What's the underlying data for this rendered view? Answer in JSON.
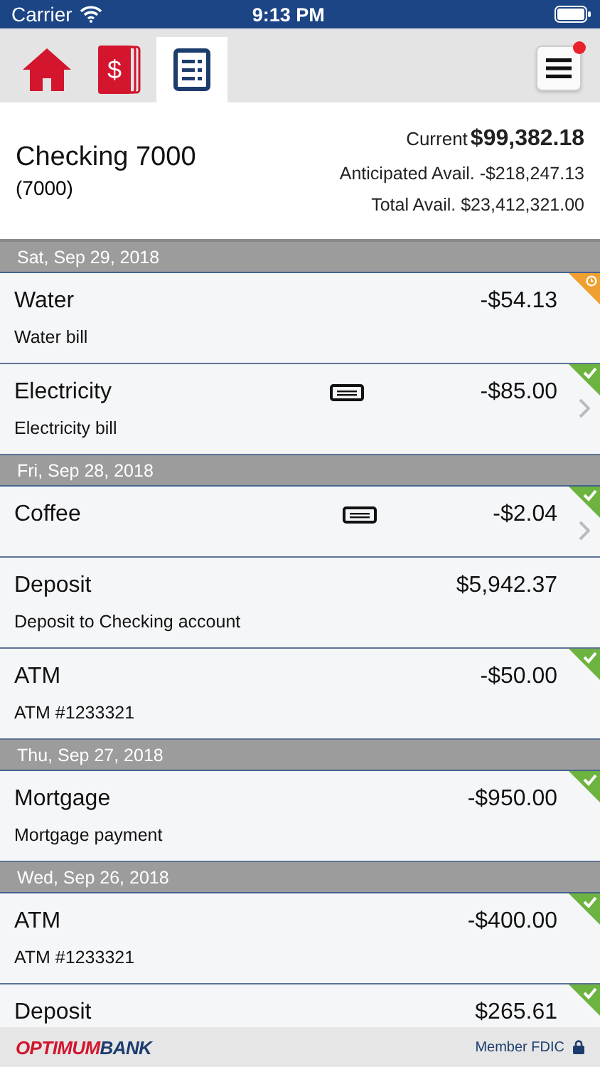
{
  "status_bar": {
    "carrier": "Carrier",
    "time": "9:13 PM"
  },
  "tabs": [
    {
      "kind": "home",
      "selected": false
    },
    {
      "kind": "money",
      "selected": false,
      "glyph": "$"
    },
    {
      "kind": "register",
      "selected": true
    }
  ],
  "menu_button": {
    "notification": true
  },
  "account": {
    "name": "Checking 7000",
    "number": "(7000)",
    "current_label": "Current",
    "current": "$99,382.18",
    "anticipated": "Anticipated Avail. -$218,247.13",
    "total": "Total Avail. $23,412,321.00"
  },
  "sections": [
    {
      "date": "Sat, Sep 29, 2018",
      "transactions": [
        {
          "title": "Water",
          "amount": "-$54.13",
          "description": "Water bill",
          "pending": true,
          "cleared": false,
          "memo": false,
          "details": false
        },
        {
          "title": "Electricity",
          "amount": "-$85.00",
          "description": "Electricity bill",
          "pending": false,
          "cleared": true,
          "memo": true,
          "details": true
        }
      ]
    },
    {
      "date": "Fri, Sep 28, 2018",
      "transactions": [
        {
          "title": "Coffee",
          "amount": "-$2.04",
          "pending": false,
          "cleared": true,
          "memo": true,
          "details": true
        },
        {
          "title": "Deposit",
          "amount": "$5,942.37",
          "description": "Deposit to Checking account",
          "pending": false,
          "cleared": false,
          "memo": false,
          "details": false
        },
        {
          "title": "ATM",
          "amount": "-$50.00",
          "description": "ATM #1233321",
          "pending": false,
          "cleared": true,
          "memo": false,
          "details": false
        }
      ]
    },
    {
      "date": "Thu, Sep 27, 2018",
      "transactions": [
        {
          "title": "Mortgage",
          "amount": "-$950.00",
          "description": "Mortgage payment",
          "pending": false,
          "cleared": true,
          "memo": false,
          "details": false
        }
      ]
    },
    {
      "date": "Wed, Sep 26, 2018",
      "transactions": [
        {
          "title": "ATM",
          "amount": "-$400.00",
          "description": "ATM #1233321",
          "pending": false,
          "cleared": true,
          "memo": false,
          "details": false
        },
        {
          "title": "Deposit",
          "amount": "$265.61",
          "pending": false,
          "cleared": true,
          "memo": false,
          "details": false
        }
      ]
    }
  ],
  "footer": {
    "logo_first": "OPTIMUM",
    "logo_second": "BANK",
    "fdic": "Member FDIC"
  }
}
